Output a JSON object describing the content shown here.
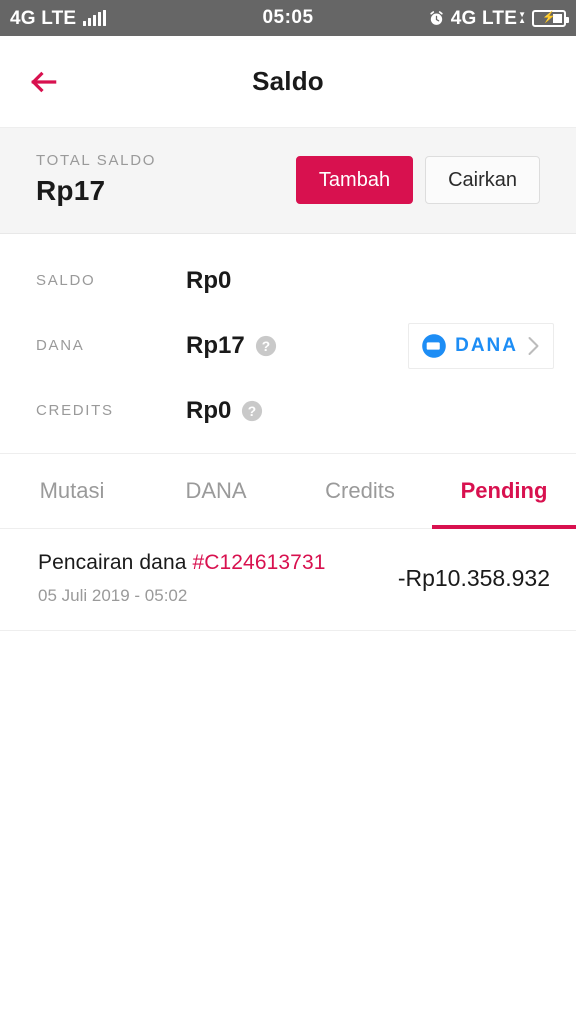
{
  "statusbar": {
    "carrier": "4G LTE",
    "time": "05:05",
    "network_right": "4G LTE",
    "icons": {
      "signal": "signal-bars-icon",
      "alarm": "alarm-clock-icon",
      "data_up": "data-up-arrow-icon",
      "data_down": "data-down-arrow-icon",
      "battery": "battery-charging-icon"
    }
  },
  "appbar": {
    "title": "Saldo",
    "back_label": "back-arrow"
  },
  "total_card": {
    "label": "TOTAL SALDO",
    "value": "Rp17",
    "primary_button": "Tambah",
    "secondary_button": "Cairkan"
  },
  "balances": [
    {
      "label": "SALDO",
      "value": "Rp0",
      "has_help": false,
      "badge": null
    },
    {
      "label": "DANA",
      "value": "Rp17",
      "has_help": true,
      "badge": "DANA"
    },
    {
      "label": "CREDITS",
      "value": "Rp0",
      "has_help": true,
      "badge": null
    }
  ],
  "tabs": [
    {
      "label": "Mutasi",
      "active": false
    },
    {
      "label": "DANA",
      "active": false
    },
    {
      "label": "Credits",
      "active": false
    },
    {
      "label": "Pending",
      "active": true
    }
  ],
  "transactions": [
    {
      "title": "Pencairan dana ",
      "reference": "#C124613731",
      "date": "05 Juli 2019 - 05:02",
      "amount": "-Rp10.358.932"
    }
  ],
  "colors": {
    "accent": "#d8114f",
    "statusbar_bg": "#666666",
    "card_bg": "#f5f5f5",
    "muted_text": "#9a9a9a",
    "dana_blue": "#1d8df5"
  }
}
